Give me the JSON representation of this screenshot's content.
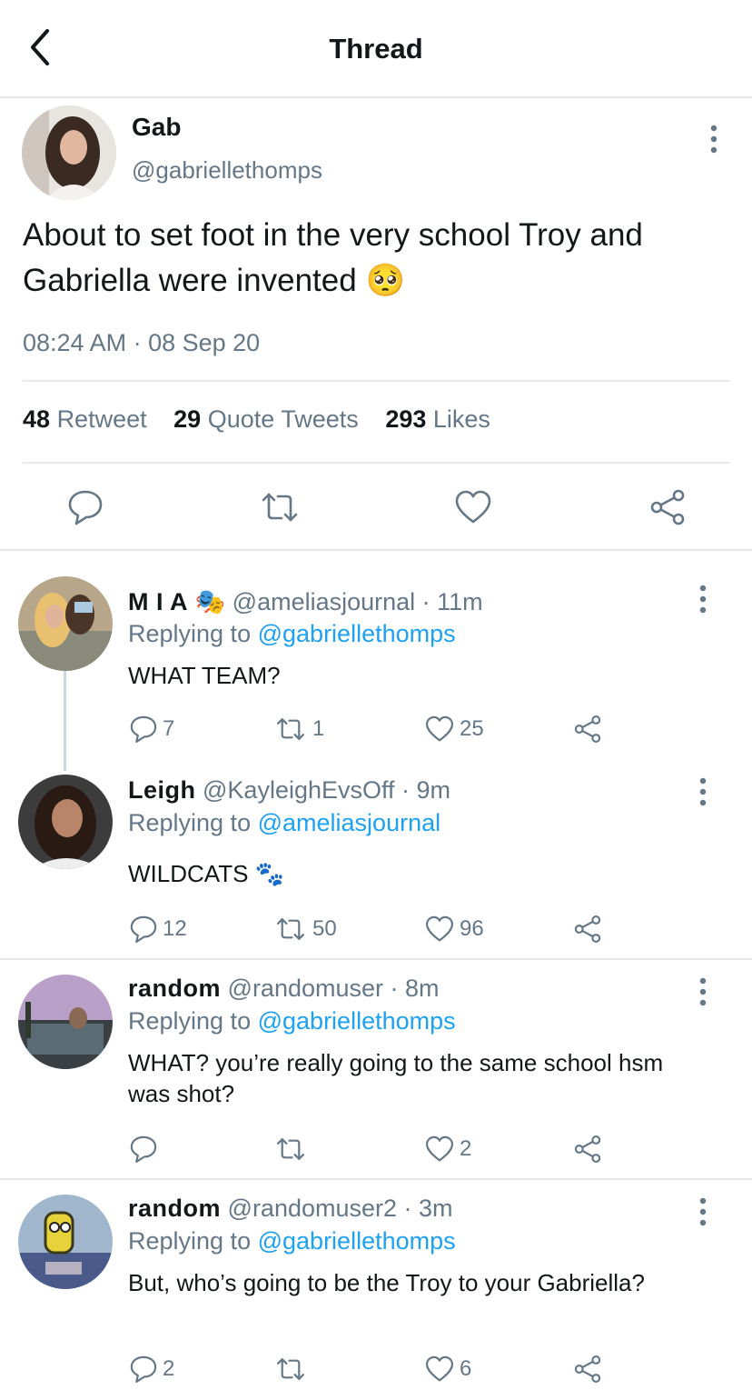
{
  "header": {
    "title": "Thread"
  },
  "main_tweet": {
    "name": "Gab",
    "handle": "@gabriellethomps",
    "text": "About to set foot in the very school Troy and Gabriella were invented",
    "emoji": "🥺",
    "timestamp": "08:24 AM · 08 Sep 20",
    "stats": {
      "retweets_count": "48",
      "retweets_label": "Retweet",
      "quotes_count": "29",
      "quotes_label": "Quote Tweets",
      "likes_count": "293",
      "likes_label": "Likes"
    }
  },
  "replies": [
    {
      "name": "M I A",
      "name_emoji": "🎭",
      "handle_time": "@ameliasjournal · 11m",
      "replying_label": "Replying to",
      "replying_to": "@gabriellethomps",
      "text": "WHAT TEAM?",
      "comments": "7",
      "retweets": "1",
      "likes": "25"
    },
    {
      "name": "Leigh",
      "handle_time": "@KayleighEvsOff · 9m",
      "replying_label": "Replying to",
      "replying_to": "@ameliasjournal",
      "text": "WILDCATS",
      "text_emoji": "🐾",
      "comments": "12",
      "retweets": "50",
      "likes": "96"
    },
    {
      "name": "random",
      "handle_time": "@randomuser · 8m",
      "replying_label": "Replying to",
      "replying_to": "@gabriellethomps",
      "text": "WHAT? you’re really going to the same school hsm was shot?",
      "comments": "",
      "retweets": "",
      "likes": "2"
    },
    {
      "name": "random",
      "handle_time": "@randomuser2 · 3m",
      "replying_label": "Replying to",
      "replying_to": "@gabriellethomps",
      "text": "But, who’s going to be the Troy to your Gabriella?",
      "comments": "2",
      "retweets": "",
      "likes": "6"
    }
  ],
  "colors": {
    "link": "#1da1f2",
    "secondary_text": "#657786",
    "divider": "#e3e5e8",
    "icon": "#657786"
  }
}
